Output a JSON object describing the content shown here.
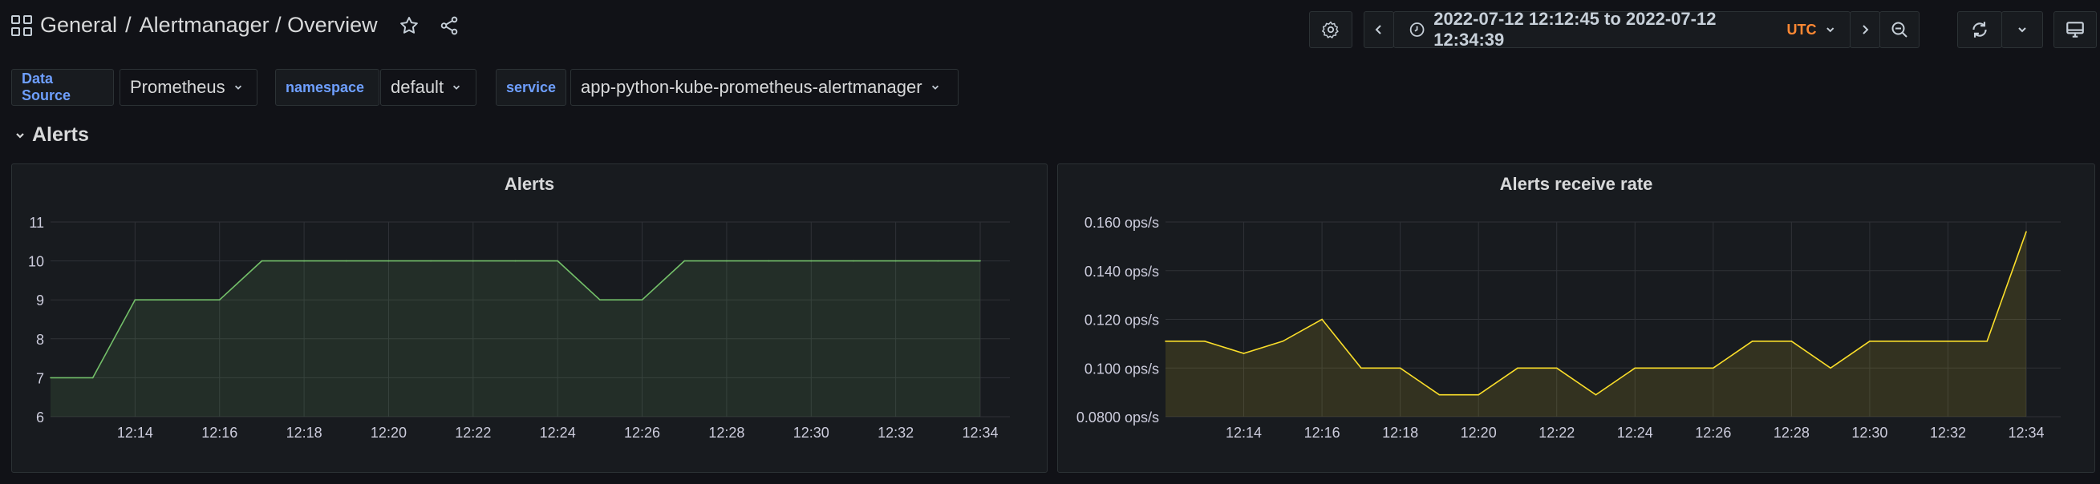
{
  "breadcrumb": {
    "folder": "General",
    "separator": "/",
    "title": "Alertmanager / Overview"
  },
  "time_range": {
    "text": "2022-07-12 12:12:45 to 2022-07-12 12:34:39",
    "timezone": "UTC"
  },
  "variables": [
    {
      "label": "Data Source",
      "value": "Prometheus"
    },
    {
      "label": "namespace",
      "value": "default"
    },
    {
      "label": "service",
      "value": "app-python-kube-prometheus-alertmanager"
    }
  ],
  "row": {
    "title": "Alerts"
  },
  "colors": {
    "bg": "#111217",
    "panel": "#181b1f",
    "alerts_line": "#73bf69",
    "rate_line": "#fade2a",
    "accent": "#6e9fff",
    "tz": "#ff8833"
  },
  "panels": [
    {
      "title": "Alerts",
      "chart_data": {
        "type": "line",
        "title": "Alerts",
        "x": [
          "12:12",
          "12:13",
          "12:14",
          "12:15",
          "12:16",
          "12:17",
          "12:18",
          "12:19",
          "12:20",
          "12:21",
          "12:22",
          "12:23",
          "12:24",
          "12:25",
          "12:26",
          "12:27",
          "12:28",
          "12:29",
          "12:30",
          "12:31",
          "12:32",
          "12:33",
          "12:34"
        ],
        "series": [
          {
            "values": [
              7,
              7,
              9,
              9,
              9,
              10,
              10,
              10,
              10,
              10,
              10,
              10,
              10,
              9,
              9,
              10,
              10,
              10,
              10,
              10,
              10,
              10,
              10
            ]
          }
        ],
        "x_ticks": [
          "12:14",
          "12:16",
          "12:18",
          "12:20",
          "12:22",
          "12:24",
          "12:26",
          "12:28",
          "12:30",
          "12:32",
          "12:34"
        ],
        "y_ticks": [
          "6",
          "7",
          "8",
          "9",
          "10",
          "11"
        ],
        "ylim": [
          6,
          11
        ],
        "grid": true,
        "area_fill": true
      }
    },
    {
      "title": "Alerts receive rate",
      "chart_data": {
        "type": "line",
        "title": "Alerts receive rate",
        "x": [
          "12:12",
          "12:13",
          "12:14",
          "12:15",
          "12:16",
          "12:17",
          "12:18",
          "12:19",
          "12:20",
          "12:21",
          "12:22",
          "12:23",
          "12:24",
          "12:25",
          "12:26",
          "12:27",
          "12:28",
          "12:29",
          "12:30",
          "12:31",
          "12:32",
          "12:33",
          "12:34"
        ],
        "series": [
          {
            "values": [
              0.111,
              0.111,
              0.106,
              0.111,
              0.12,
              0.1,
              0.1,
              0.089,
              0.089,
              0.1,
              0.1,
              0.089,
              0.1,
              0.1,
              0.1,
              0.111,
              0.111,
              0.1,
              0.111,
              0.111,
              0.111,
              0.111,
              0.156
            ]
          }
        ],
        "x_ticks": [
          "12:14",
          "12:16",
          "12:18",
          "12:20",
          "12:22",
          "12:24",
          "12:26",
          "12:28",
          "12:30",
          "12:32",
          "12:34"
        ],
        "y_ticks": [
          "0.0800 ops/s",
          "0.100 ops/s",
          "0.120 ops/s",
          "0.140 ops/s",
          "0.160 ops/s"
        ],
        "ylim": [
          0.08,
          0.16
        ],
        "grid": true,
        "area_fill": true
      }
    }
  ]
}
